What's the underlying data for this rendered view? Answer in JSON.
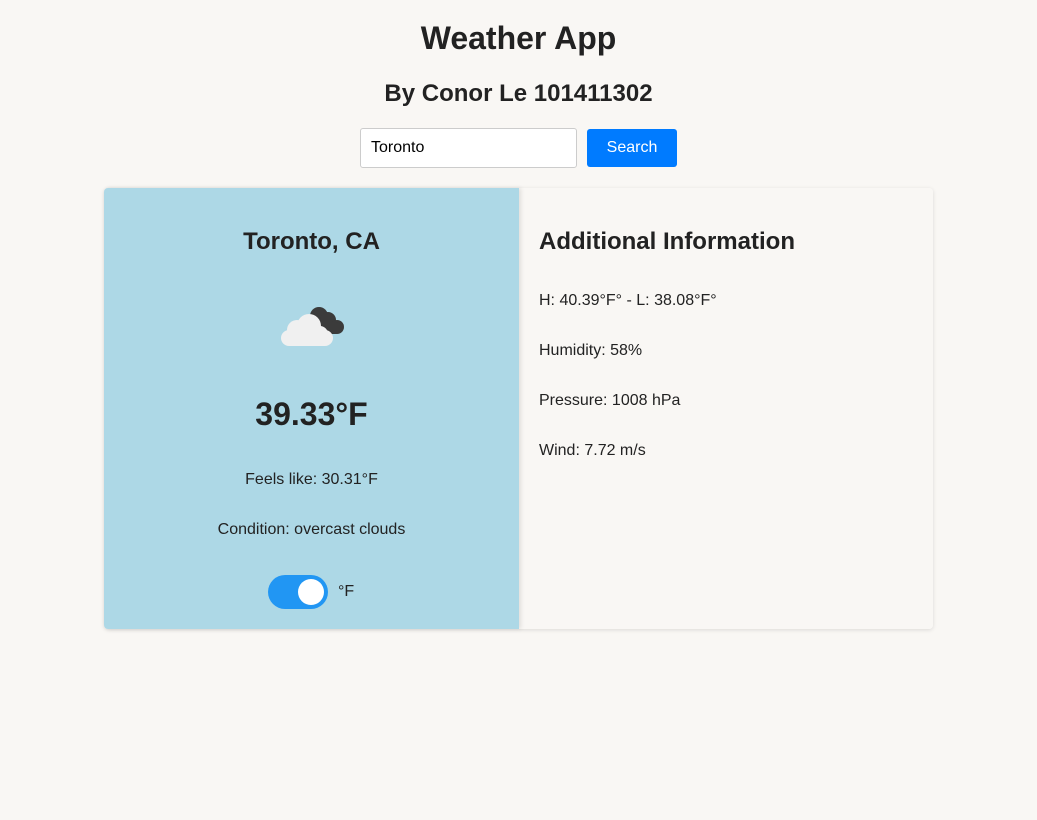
{
  "header": {
    "title": "Weather App",
    "subtitle": "By Conor Le 101411302"
  },
  "search": {
    "value": "Toronto",
    "button_label": "Search"
  },
  "weather": {
    "city": "Toronto, CA",
    "icon": "overcast-clouds-icon",
    "temperature": "39.33°F",
    "feels_like": "Feels like: 30.31°F",
    "condition": "Condition: overcast clouds",
    "unit_toggle_on": true,
    "unit_label": "°F"
  },
  "additional": {
    "title": "Additional Information",
    "high_low": "H: 40.39°F° - L: 38.08°F°",
    "humidity": "Humidity: 58%",
    "pressure": "Pressure: 1008 hPa",
    "wind": "Wind: 7.72 m/s"
  },
  "colors": {
    "background": "#f9f7f4",
    "weather_card": "#add8e6",
    "accent": "#007bff",
    "toggle": "#2196f3"
  }
}
